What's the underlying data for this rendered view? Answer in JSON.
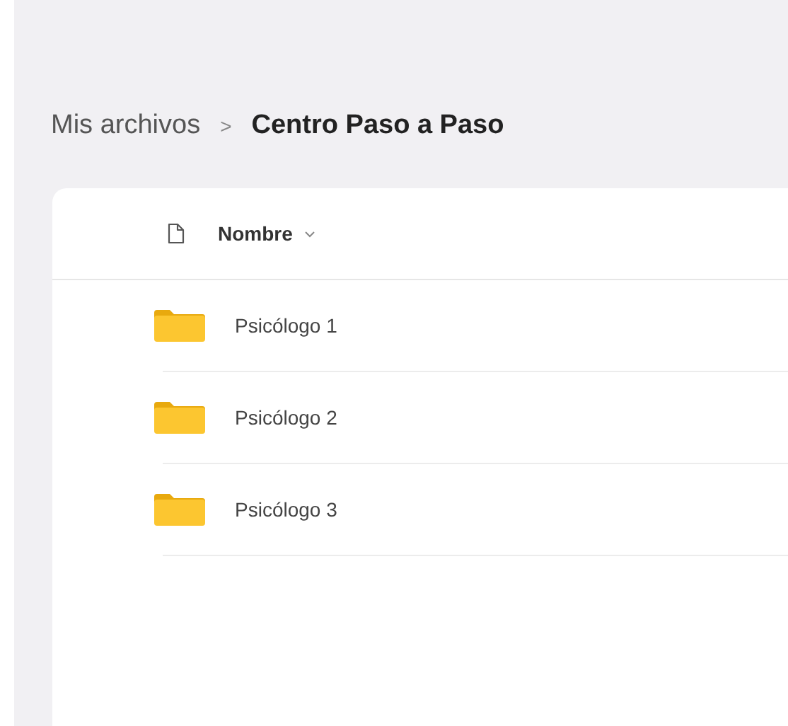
{
  "breadcrumb": [
    {
      "label": "Mis archivos",
      "current": false
    },
    {
      "label": "Centro Paso a Paso",
      "current": true
    }
  ],
  "breadcrumb_separator": ">",
  "table": {
    "columns": [
      {
        "label": "Nombre",
        "sorted": true
      }
    ],
    "rows": [
      {
        "name": "Psicólogo 1",
        "kind": "folder"
      },
      {
        "name": "Psicólogo 2",
        "kind": "folder"
      },
      {
        "name": "Psicólogo 3",
        "kind": "folder"
      }
    ]
  }
}
